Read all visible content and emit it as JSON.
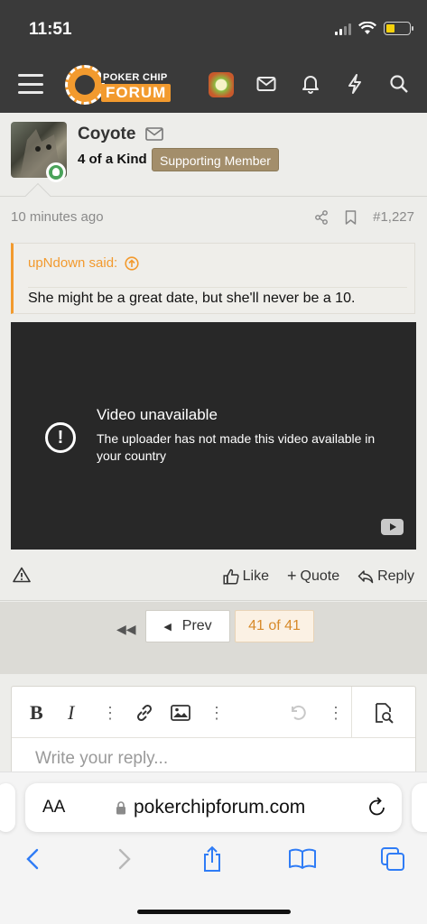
{
  "status": {
    "time": "11:51"
  },
  "header": {
    "logo_line1": "POKER CHIP",
    "logo_line2": "FORUM"
  },
  "post": {
    "username": "Coyote",
    "user_title": "4 of a Kind",
    "badge": "Supporting Member",
    "time": "10 minutes ago",
    "post_number": "#1,227",
    "quote": {
      "source": "upNdown said:",
      "text": "She might be a great date, but she'll never be a 10."
    },
    "video": {
      "title": "Video unavailable",
      "message": "The uploader has not made this video available in your country"
    }
  },
  "actions": {
    "like": "Like",
    "quote": "Quote",
    "reply": "Reply"
  },
  "pagination": {
    "prev": "Prev",
    "current": "41 of 41"
  },
  "editor": {
    "placeholder": "Write your reply..."
  },
  "browser": {
    "aa": "AA",
    "url": "pokerchipforum.com"
  },
  "colors": {
    "accent": "#f29a2e",
    "header_bg": "#3a3a3a",
    "badge_bg": "#a38e6b",
    "link_blue": "#2f7cf6"
  }
}
